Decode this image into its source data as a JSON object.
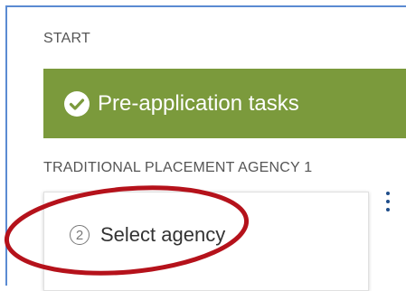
{
  "start_section": {
    "label": "START"
  },
  "banner": {
    "title": "Pre-application tasks",
    "icon": "check-circle-icon",
    "color": "#7b9a3c"
  },
  "agency_section": {
    "label": "TRADITIONAL PLACEMENT AGENCY 1"
  },
  "task_card": {
    "step_number": "2",
    "label": "Select agency"
  },
  "menu": {
    "icon": "kebab-menu-icon"
  },
  "annotation": {
    "color": "#b5121b"
  }
}
